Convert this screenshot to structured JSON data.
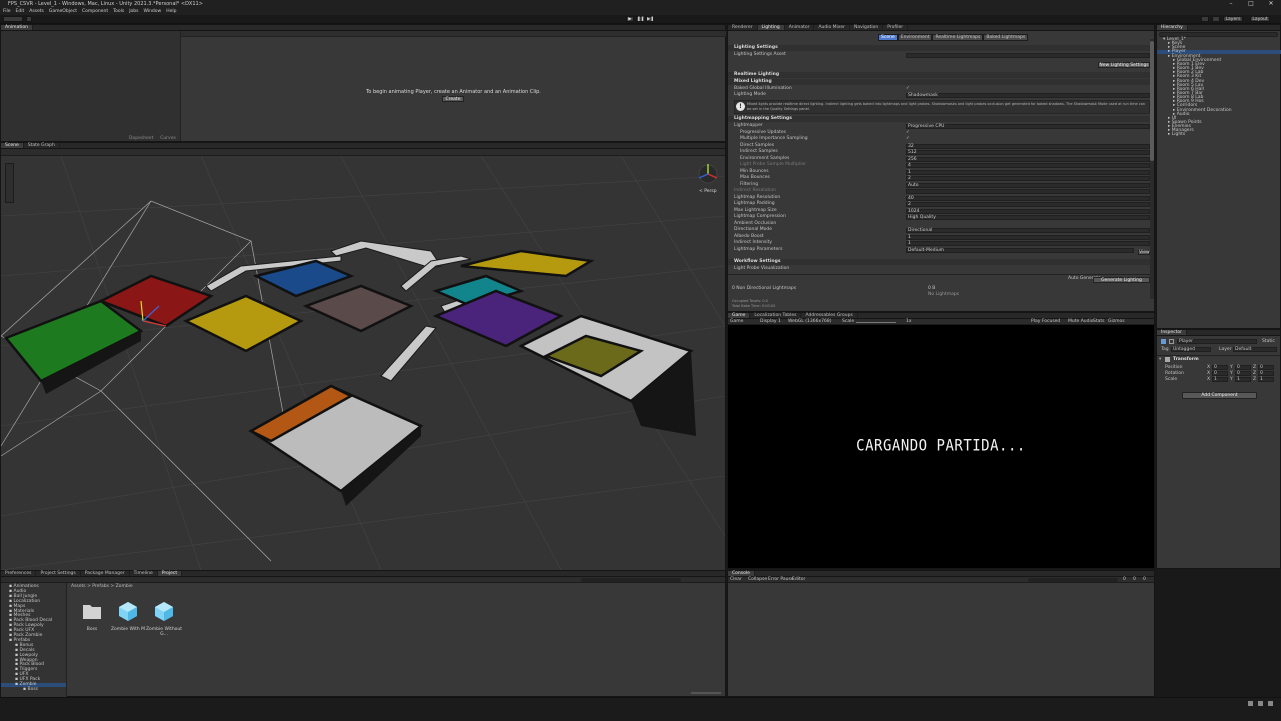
{
  "window": {
    "title": "FPS_CSVR - Level_1 - Windows, Mac, Linux - Unity 2021.3.*Personal* <DX11>"
  },
  "menu": [
    "File",
    "Edit",
    "Assets",
    "GameObject",
    "Component",
    "Tools",
    "Jobs",
    "Window",
    "Help"
  ],
  "animator_panel": {
    "tab": "Animation",
    "message": "To begin animating Player, create an Animator and an Animation Clip.",
    "create_label": "Create",
    "bottom_tabs": [
      "Dopesheet",
      "Curves"
    ]
  },
  "scene_panel": {
    "tabs": [
      "Scene",
      "State Graph"
    ],
    "gizmo_label": "< Persp"
  },
  "lighting_tabs": [
    "Renderer",
    "Lighting",
    "Animator",
    "Audio Mixer",
    "Navigation",
    "Profiler"
  ],
  "lighting_subtabs": [
    "Scene",
    "Environment",
    "Realtime Lightmaps",
    "Baked Lightmaps"
  ],
  "lighting": {
    "settings_header": "Lighting Settings",
    "settings_asset_label": "Lighting Settings Asset",
    "new_settings_btn": "New Lighting Settings",
    "realtime_header": "Realtime Lighting",
    "mixed_header": "Mixed Lighting",
    "baked_gi_label": "Baked Global Illumination",
    "lighting_mode_label": "Lighting Mode",
    "lighting_mode_value": "Shadowmask",
    "info_text": "Mixed lights provide realtime direct lighting. Indirect lighting gets baked into lightmaps and light probes. Shadowmasks and light probes occlusion get generated for baked shadows. The Shadowmask Mode used at run time can be set in the Quality Settings panel.",
    "lightmapping_header": "Lightmapping Settings",
    "rows": [
      {
        "label": "Lightmapper",
        "value": "Progressive CPU"
      },
      {
        "label": "Progressive Updates",
        "value": "✓"
      },
      {
        "label": "Multiple Importance Sampling",
        "value": "✓"
      },
      {
        "label": "Direct Samples",
        "value": "32"
      },
      {
        "label": "Indirect Samples",
        "value": "512"
      },
      {
        "label": "Environment Samples",
        "value": "256"
      },
      {
        "label": "Light Probe Sample Multiplier",
        "value": "4"
      },
      {
        "label": "Min Bounces",
        "value": "1"
      },
      {
        "label": "Max Bounces",
        "value": "2"
      },
      {
        "label": "Filtering",
        "value": "Auto"
      },
      {
        "label": "Indirect Resolution",
        "value": ""
      },
      {
        "label": "Lightmap Resolution",
        "value": "40"
      },
      {
        "label": "Lightmap Padding",
        "value": "2"
      },
      {
        "label": "Max Lightmap Size",
        "value": "1024"
      },
      {
        "label": "Lightmap Compression",
        "value": "High Quality"
      },
      {
        "label": "Ambient Occlusion",
        "value": ""
      },
      {
        "label": "Directional Mode",
        "value": "Directional"
      },
      {
        "label": "Albedo Boost",
        "value": "1"
      },
      {
        "label": "Indirect Intensity",
        "value": "1"
      },
      {
        "label": "Lightmap Parameters",
        "value": "Default-Medium"
      }
    ],
    "res_units_1": "texels per unit",
    "res_units_2": "texels",
    "view_btn": "View",
    "workflow_header": "Workflow Settings",
    "probe_vis_label": "Light Probe Visualization",
    "auto_generate": "Auto Generate",
    "generate_btn": "Generate Lighting",
    "baked_lightmaps_label": "0 Non Directional Lightmaps",
    "baked_size": "0 B",
    "no_lightmaps": "No Lightmaps",
    "occupied_texels": "Occupied Texels: 0.0",
    "total_bake_time": "Total Bake Time: 0:00:00"
  },
  "game_panel": {
    "tabs": [
      "Game",
      "Localization Tables",
      "Addressables Groups"
    ],
    "display": "Display 1",
    "resolution": "WebGL (1366x768)",
    "scale_label": "Scale",
    "scale_value": "1x",
    "right_opts": [
      "Play Focused",
      "Mute Audio",
      "Stats",
      "Gizmos"
    ],
    "mode_label": "Game",
    "loading_text": "CARGANDO PARTIDA..."
  },
  "hierarchy": {
    "tab": "Hierarchy",
    "items": [
      {
        "label": "Level_1*",
        "depth": 0
      },
      {
        "label": "Keys",
        "depth": 1
      },
      {
        "label": "Scene",
        "depth": 1
      },
      {
        "label": "Player",
        "depth": 1
      },
      {
        "label": "Environment",
        "depth": 1
      },
      {
        "label": "Global Environment",
        "depth": 2
      },
      {
        "label": "Room 1 Elev",
        "depth": 2
      },
      {
        "label": "Room 1 Bev",
        "depth": 2
      },
      {
        "label": "Room 2 Lab",
        "depth": 2
      },
      {
        "label": "Room 3 Kit",
        "depth": 2
      },
      {
        "label": "Room 4 Dev",
        "depth": 2
      },
      {
        "label": "Room 5 Lav",
        "depth": 2
      },
      {
        "label": "Room 6 Hall",
        "depth": 2
      },
      {
        "label": "Room 7 Bar",
        "depth": 2
      },
      {
        "label": "Room 8 Lab",
        "depth": 2
      },
      {
        "label": "Room 9 Hos",
        "depth": 2
      },
      {
        "label": "Corridors",
        "depth": 2
      },
      {
        "label": "Environment Decoration",
        "depth": 2
      },
      {
        "label": "Audio",
        "depth": 2
      },
      {
        "label": "UI",
        "depth": 1
      },
      {
        "label": "Spawn Points",
        "depth": 1
      },
      {
        "label": "Enemies",
        "depth": 1
      },
      {
        "label": "Managers",
        "depth": 1
      },
      {
        "label": "Lights",
        "depth": 1
      }
    ]
  },
  "inspector": {
    "tab": "Inspector",
    "object_name": "Player",
    "static_label": "Static",
    "tag_label": "Tag",
    "tag_value": "Untagged",
    "layer_label": "Layer",
    "layer_value": "Default",
    "transform_label": "Transform",
    "position_label": "Position",
    "rotation_label": "Rotation",
    "scale_label": "Scale",
    "position": [
      "0",
      "0",
      "0"
    ],
    "rotation": [
      "0",
      "0",
      "0"
    ],
    "scale": [
      "1",
      "1",
      "1"
    ],
    "add_component": "Add Component"
  },
  "project": {
    "tabs": [
      "Preferences",
      "Project Settings",
      "Package Manager",
      "Timeline",
      "Project"
    ],
    "breadcrumb": "Assets > Prefabs > Zombie",
    "tree": [
      "Animations",
      "Audio",
      "Ball Jungle",
      "Localization",
      "Maps",
      "Materials",
      "Meshes",
      "Pack Blood Decal",
      "Pack Lowpoly",
      "Pack UFX",
      "Pack Zombie",
      "Prefabs",
      "Bonus",
      "Decals",
      "Lowpoly",
      "Weapon",
      "Pack Blood",
      "Triggers",
      "UFX",
      "UFX Pack",
      "Zombie",
      "Boss"
    ],
    "assets": [
      {
        "label": "Boss",
        "kind": "folder"
      },
      {
        "label": "Zombie With M",
        "kind": "prefab"
      },
      {
        "label": "Zombie Without G...",
        "kind": "prefab"
      }
    ]
  },
  "console": {
    "tab": "Console",
    "controls": [
      "Clear",
      "Collapse",
      "Error Pause",
      "Editor"
    ],
    "counts": [
      "0",
      "0",
      "0"
    ]
  },
  "colors": {
    "accent": "#4d78cc",
    "room_green": "#1e7a1e",
    "room_red": "#8a1616",
    "room_yellow": "#b59a10",
    "room_blue": "#1a4a8a",
    "room_purple": "#4a237a",
    "room_orange": "#b25714",
    "room_teal": "#12848c",
    "room_olive": "#6b6a1a"
  }
}
